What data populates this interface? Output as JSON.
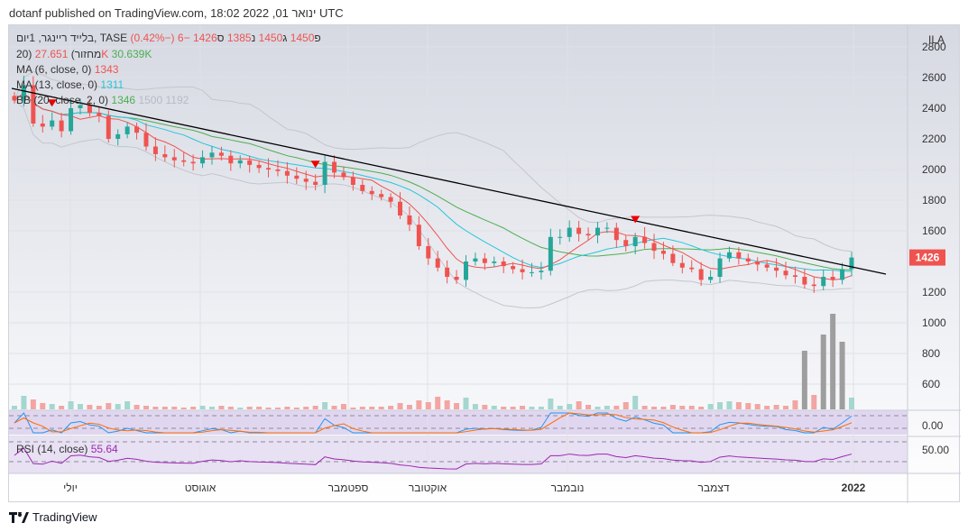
{
  "header": {
    "published": "dotanf published on TradingView.com, 18:02 2022 ,01 ינואר UTC"
  },
  "legend": {
    "symbol": "בלייד ריינגר, 1יום, TASE",
    "o_label": "פ",
    "o": "1450",
    "h_label": "ג",
    "h": "1450",
    "l_label": "נ",
    "l": "1385",
    "c_label": "ס",
    "c": "1426",
    "change": "−6 (−0.42%)",
    "volume_label": "20) מחזור)",
    "volume_val": "27.651K",
    "volume_ma": "30.639K",
    "ma6_label": "MA (6, close, 0)",
    "ma6_val": "1343",
    "ma13_label": "MA (13, close, 0)",
    "ma13_val": "1311",
    "bb_label": "BB (20, close, 2, 0)",
    "bb_val": "1346",
    "bb_upper": "1500",
    "bb_lower": "1192"
  },
  "rsi": {
    "label": "RSI (14, close)",
    "value": "55.64"
  },
  "price_axis": {
    "currency": "ILA",
    "ticks": [
      "2800",
      "2600",
      "2400",
      "2200",
      "2000",
      "1800",
      "1600",
      "1200",
      "1000",
      "800",
      "600"
    ],
    "last_price": "1426",
    "stoch_tick": "0.00",
    "rsi_tick": "50.00"
  },
  "time_axis": [
    "יולי",
    "אוגוסט",
    "ספטמבר",
    "אוקטובר",
    "נובמבר",
    "דצמבר",
    "2022"
  ],
  "footer": {
    "brand": "TradingView"
  },
  "colors": {
    "up": "#26a69a",
    "down": "#ef5350",
    "ma6": "#ef5350",
    "ma13": "#26c6da",
    "bb": "#4caf50",
    "rsi": "#9c27b0"
  },
  "chart_data": {
    "type": "candlestick",
    "closes": [
      2450,
      2550,
      2300,
      2280,
      2320,
      2250,
      2400,
      2420,
      2370,
      2350,
      2200,
      2230,
      2280,
      2240,
      2150,
      2100,
      2080,
      2060,
      2050,
      2040,
      2080,
      2110,
      2090,
      2040,
      2060,
      2030,
      2010,
      2000,
      1990,
      1960,
      1940,
      1920,
      1900,
      2050,
      1980,
      1950,
      1900,
      1860,
      1840,
      1820,
      1790,
      1700,
      1640,
      1500,
      1420,
      1360,
      1300,
      1280,
      1400,
      1420,
      1390,
      1400,
      1370,
      1350,
      1330,
      1330,
      1340,
      1560,
      1560,
      1620,
      1580,
      1570,
      1620,
      1620,
      1540,
      1500,
      1560,
      1520,
      1470,
      1450,
      1390,
      1360,
      1350,
      1280,
      1300,
      1420,
      1460,
      1420,
      1400,
      1380,
      1360,
      1340,
      1310,
      1300,
      1250,
      1240,
      1300,
      1280,
      1350,
      1426
    ],
    "volume": [
      40,
      150,
      110,
      70,
      60,
      40,
      90,
      60,
      50,
      40,
      70,
      60,
      90,
      50,
      40,
      30,
      30,
      30,
      20,
      30,
      40,
      30,
      40,
      30,
      20,
      30,
      30,
      20,
      20,
      30,
      20,
      30,
      40,
      80,
      40,
      60,
      20,
      30,
      30,
      30,
      40,
      70,
      50,
      100,
      80,
      140,
      100,
      70,
      130,
      60,
      50,
      40,
      30,
      30,
      40,
      30,
      30,
      120,
      40,
      60,
      90,
      50,
      30,
      40,
      40,
      80,
      150,
      40,
      30,
      30,
      50,
      40,
      40,
      30,
      60,
      80,
      90,
      80,
      70,
      60,
      40,
      50,
      40,
      100,
      650,
      160,
      830,
      1060,
      750,
      130
    ],
    "markers": [
      4,
      32,
      66
    ]
  }
}
